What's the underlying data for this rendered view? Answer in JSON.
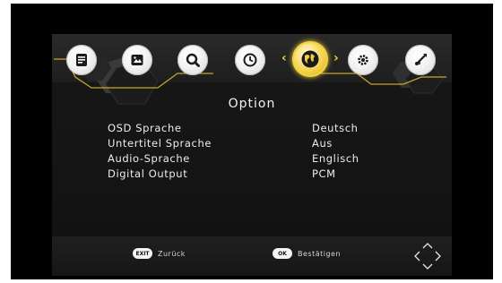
{
  "menu": {
    "tabs": [
      {
        "icon": "info-icon"
      },
      {
        "icon": "picture-icon"
      },
      {
        "icon": "search-icon"
      },
      {
        "icon": "clock-icon"
      },
      {
        "icon": "globe-icon",
        "active": true
      },
      {
        "icon": "settings-icon"
      },
      {
        "icon": "usb-icon"
      }
    ]
  },
  "title": "Option",
  "settings": [
    {
      "label": "OSD Sprache",
      "value": "Deutsch"
    },
    {
      "label": "Untertitel Sprache",
      "value": "Aus"
    },
    {
      "label": "Audio-Sprache",
      "value": "Englisch"
    },
    {
      "label": "Digital Output",
      "value": "PCM"
    }
  ],
  "footer": {
    "exit_key": "EXIT",
    "exit_label": "Zurück",
    "ok_key": "OK",
    "ok_label": "Bestätigen"
  },
  "colors": {
    "accent": "#f2cf3a",
    "background": "#000000",
    "panel": "#161616"
  }
}
